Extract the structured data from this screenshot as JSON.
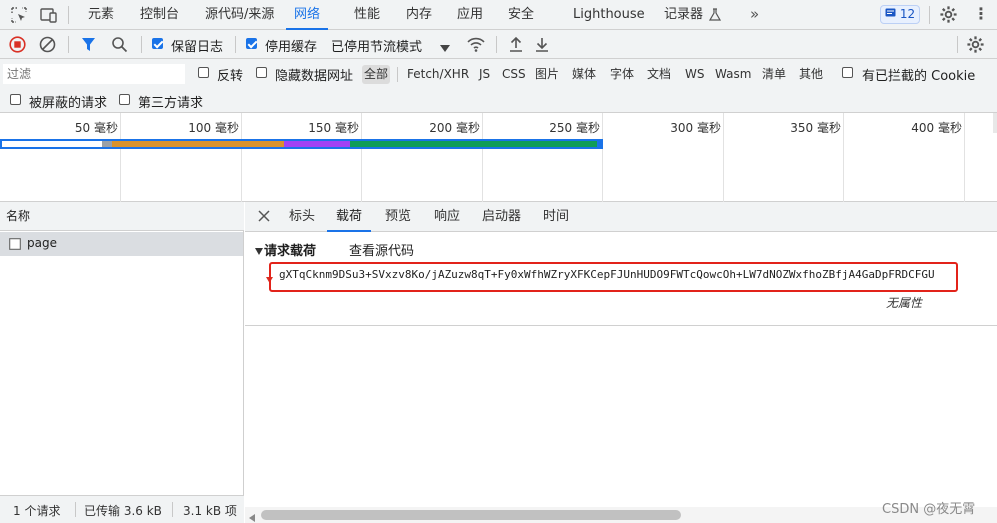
{
  "tabs": [
    {
      "label": "元素"
    },
    {
      "label": "控制台"
    },
    {
      "label": "源代码/来源"
    },
    {
      "label": "网络"
    },
    {
      "label": "性能"
    },
    {
      "label": "内存"
    },
    {
      "label": "应用"
    },
    {
      "label": "安全"
    },
    {
      "label": "Lighthouse"
    },
    {
      "label": "记录器"
    }
  ],
  "issues_count": "12",
  "toolbar": {
    "preserve_log": "保留日志",
    "disable_cache": "停用缓存",
    "throttling": "已停用节流模式"
  },
  "filter": {
    "placeholder": "过滤",
    "invert": "反转",
    "hide_data_urls": "隐藏数据网址",
    "types": [
      "全部",
      "Fetch/XHR",
      "JS",
      "CSS",
      "图片",
      "媒体",
      "字体",
      "文档",
      "WS",
      "Wasm",
      "清单",
      "其他"
    ],
    "blocked_cookies": "有已拦截的 Cookie",
    "blocked_requests": "被屏蔽的请求",
    "third_party": "第三方请求"
  },
  "timeline": {
    "ticks": [
      "50 毫秒",
      "100 毫秒",
      "150 毫秒",
      "200 毫秒",
      "250 毫秒",
      "300 毫秒",
      "350 毫秒",
      "400 毫秒"
    ]
  },
  "request_list": {
    "header": "名称",
    "rows": [
      {
        "name": "page"
      }
    ]
  },
  "status": {
    "requests": "1 个请求",
    "transferred": "已传输 3.6 kB",
    "resources": "3.1 kB 项"
  },
  "detail": {
    "tabs": [
      "标头",
      "载荷",
      "预览",
      "响应",
      "启动器",
      "时间"
    ],
    "section_title": "请求载荷",
    "view_source": "查看源代码",
    "payload_value": "gXTqCknm9DSu3+SVxzv8Ko/jAZuzw8qT+Fy0xWfhWZryXFKCepFJUnHUDO9FWTcQowcOh+LW7dNOZWxfhoZBfjA4GaDpFRDCFGU",
    "no_properties": "无属性"
  },
  "watermark": "CSDN @夜无霄",
  "colors": {
    "accent": "#1a73e8",
    "record_red": "#d93025",
    "highlight_red": "#e2231a"
  }
}
